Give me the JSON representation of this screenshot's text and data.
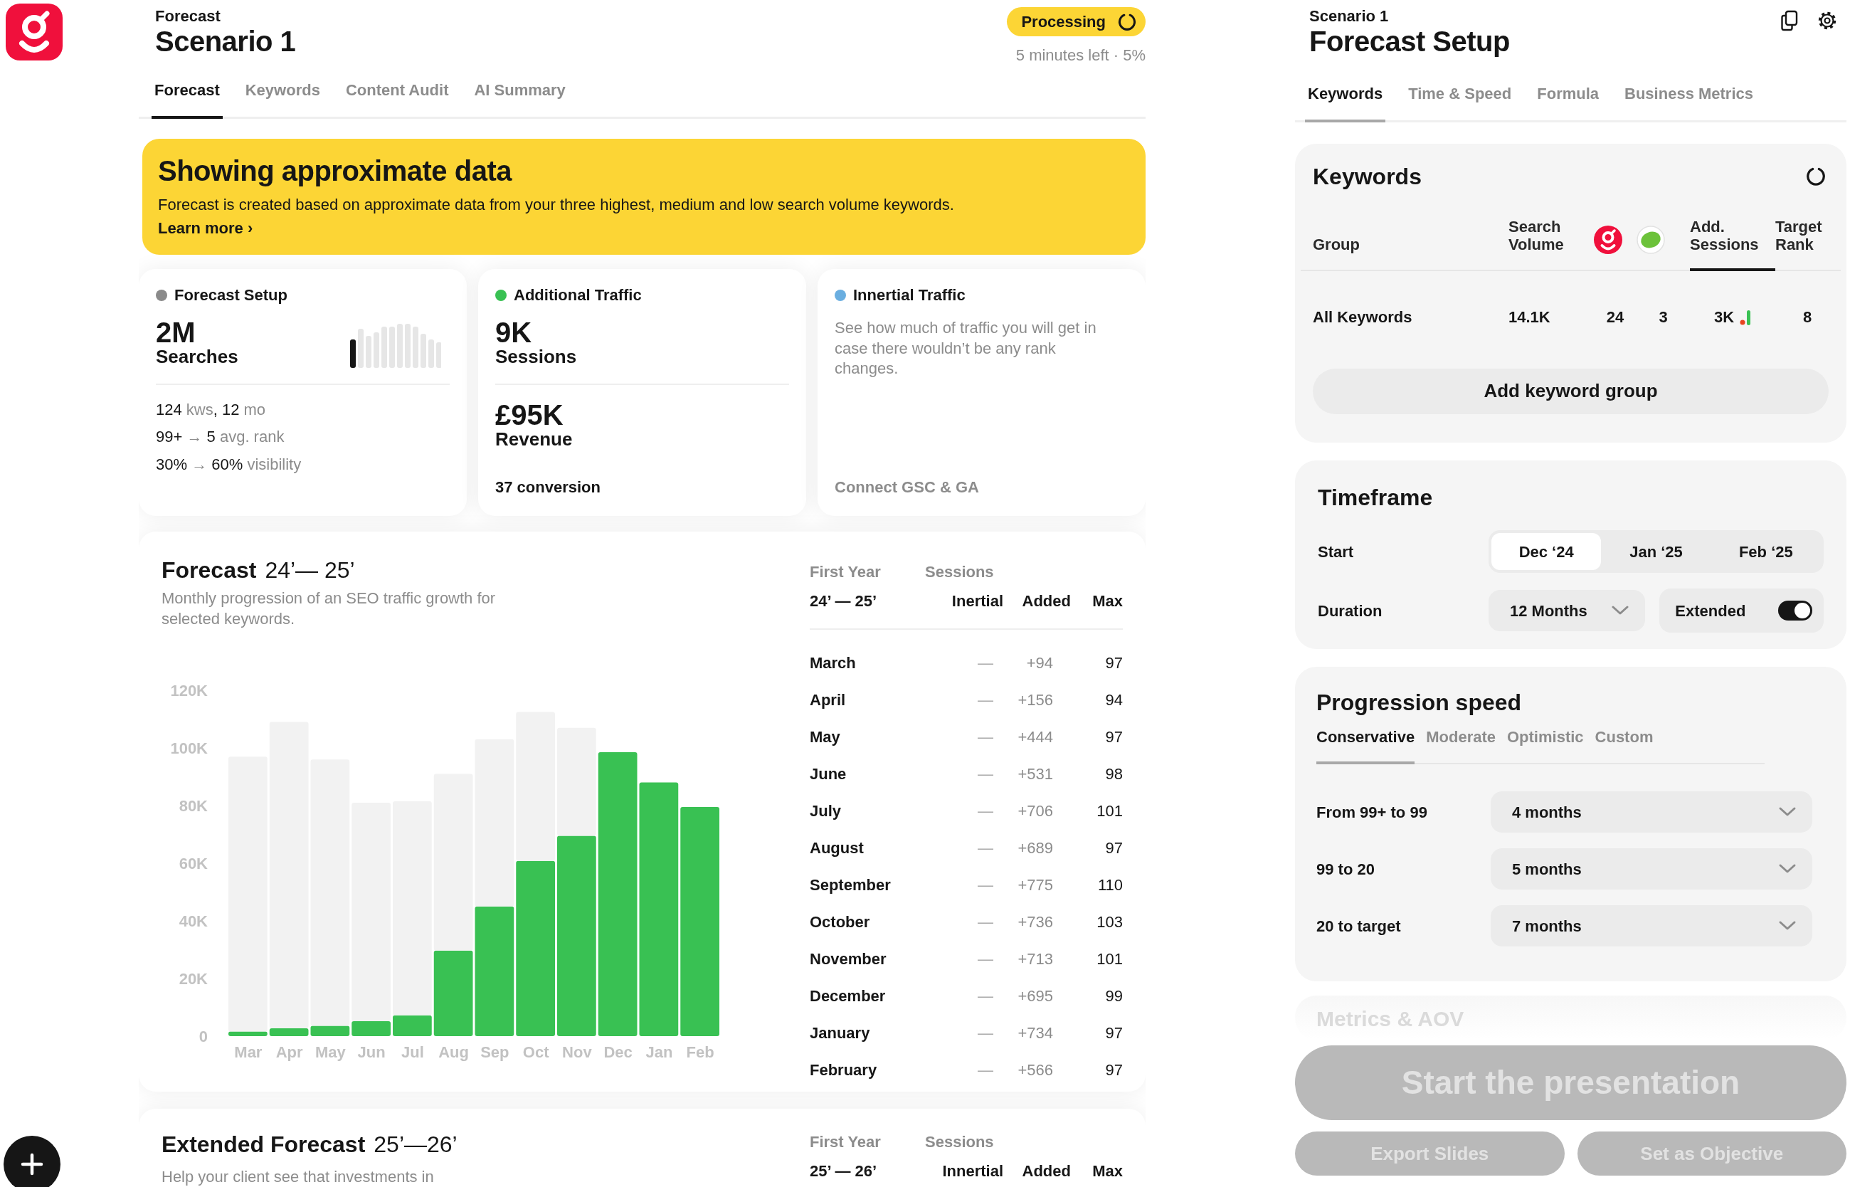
{
  "header": {
    "eyebrow": "Forecast",
    "title": "Scenario 1",
    "status": "Processing",
    "status_detail": "5 minutes left · 5%"
  },
  "tabs": [
    {
      "label": "Forecast",
      "selected": true
    },
    {
      "label": "Keywords",
      "selected": false
    },
    {
      "label": "Content Audit",
      "selected": false
    },
    {
      "label": "AI Summary",
      "selected": false
    }
  ],
  "banner": {
    "title": "Showing approximate data",
    "text": "Forecast is created based on approximate data from your three highest, medium and low search volume keywords.",
    "link": "Learn more ›"
  },
  "summary_cards": [
    {
      "kind": "setup",
      "title": "Forecast Setup",
      "color": "#8a8a8a",
      "value": "2M",
      "unit": "Searches",
      "stats": [
        "**124** kws**, 12** mo",
        "**99+** → **5** avg. rank",
        "**30%** → **60%** visibility"
      ]
    },
    {
      "kind": "traffic",
      "title": "Additional Traffic",
      "color": "#39c153",
      "value": "9K",
      "unit": "Sessions",
      "value_2": "£95K",
      "unit_2": "Revenue",
      "footer": "37 conversion"
    },
    {
      "kind": "info",
      "title": "Innertial Traffic",
      "color": "#6aaee0",
      "text": "See how much of traffic you will get in case there wouldn’t be any rank changes.",
      "link": "Connect GSC & GA"
    }
  ],
  "forecast": {
    "title": "Forecast",
    "period": "24’— 25’",
    "subtitle": "Monthly progression of an SEO traffic growth for selected keywords.",
    "chart_data": {
      "type": "bar",
      "stacked": true,
      "categories": [
        "Mar",
        "Apr",
        "May",
        "Jun",
        "Jul",
        "Aug",
        "Sep",
        "Oct",
        "Nov",
        "Dec",
        "Jan",
        "Feb"
      ],
      "series": [
        {
          "color": "#39c153",
          "values": [
            1600,
            2700,
            3600,
            5200,
            7200,
            29700,
            45000,
            60800,
            69500,
            98500,
            88000,
            79500
          ]
        },
        {
          "color": "#f2f2f2",
          "values": [
            95400,
            106300,
            92400,
            75800,
            74300,
            61300,
            58000,
            51700,
            37500,
            0,
            0,
            0
          ]
        }
      ],
      "ylim": [
        0,
        120000
      ],
      "yticks": [
        0,
        {
          "value": 20000,
          "label": "20K"
        },
        {
          "value": 40000,
          "label": "40K"
        },
        {
          "value": 60000,
          "label": "60K"
        },
        {
          "value": 80000,
          "label": "80K"
        },
        {
          "value": 100000,
          "label": "100K"
        },
        {
          "value": 120000,
          "label": "120K"
        }
      ]
    },
    "table": {
      "group_label": "First Year",
      "group_value": "24’ — 25’",
      "sessions_label": "Sessions",
      "columns": [
        "Inertial",
        "Added",
        "Max"
      ],
      "rows": [
        {
          "month": "March",
          "inertial": "—",
          "added": "+94",
          "max": "97"
        },
        {
          "month": "April",
          "inertial": "—",
          "added": "+156",
          "max": "94"
        },
        {
          "month": "May",
          "inertial": "—",
          "added": "+444",
          "max": "97"
        },
        {
          "month": "June",
          "inertial": "—",
          "added": "+531",
          "max": "98"
        },
        {
          "month": "July",
          "inertial": "—",
          "added": "+706",
          "max": "101"
        },
        {
          "month": "August",
          "inertial": "—",
          "added": "+689",
          "max": "97"
        },
        {
          "month": "September",
          "inertial": "—",
          "added": "+775",
          "max": "110"
        },
        {
          "month": "October",
          "inertial": "—",
          "added": "+736",
          "max": "103"
        },
        {
          "month": "November",
          "inertial": "—",
          "added": "+713",
          "max": "101"
        },
        {
          "month": "December",
          "inertial": "—",
          "added": "+695",
          "max": "99"
        },
        {
          "month": "January",
          "inertial": "—",
          "added": "+734",
          "max": "97"
        },
        {
          "month": "February",
          "inertial": "—",
          "added": "+566",
          "max": "97"
        }
      ]
    }
  },
  "extended_forecast": {
    "title": "Extended Forecast",
    "period": "25’—26’",
    "subtitle": "Help your client see that investments in",
    "table": {
      "group_label": "First Year",
      "group_value": "25’ — 26’",
      "sessions_label": "Sessions",
      "columns": [
        "Innertial",
        "Added",
        "Max"
      ]
    }
  },
  "setup": {
    "eyebrow": "Scenario 1",
    "title": "Forecast Setup",
    "tabs": [
      {
        "label": "Keywords",
        "selected": true
      },
      {
        "label": "Time & Speed",
        "selected": false
      },
      {
        "label": "Formula",
        "selected": false
      },
      {
        "label": "Business Metrics",
        "selected": false
      }
    ],
    "keywords": {
      "title": "Keywords",
      "columns": [
        {
          "kind": "text",
          "label": "Group",
          "selected": false
        },
        {
          "kind": "text",
          "label": "Search Volume",
          "selected": false
        },
        {
          "kind": "icon",
          "selected": false
        },
        {
          "kind": "icon",
          "selected": false
        },
        {
          "kind": "metric",
          "label": "Add. Sessions",
          "selected": true
        },
        {
          "kind": "text",
          "label": "Target Rank",
          "selected": false
        }
      ],
      "rows": [
        {
          "cells": [
            "All Keywords",
            "14.1K",
            "24",
            "3",
            "3K",
            "8"
          ]
        }
      ],
      "add_button": "Add keyword group"
    },
    "timeframe": {
      "title": "Timeframe",
      "start_label": "Start",
      "start_options": [
        {
          "label": "Dec ‘24",
          "selected": true
        },
        {
          "label": "Jan ‘25",
          "selected": false
        },
        {
          "label": "Feb ‘25",
          "selected": false
        }
      ],
      "duration_label": "Duration",
      "duration": "12 Months",
      "extended": {
        "label": "Extended",
        "on": true
      }
    },
    "progression": {
      "title": "Progression speed",
      "tabs": [
        {
          "label": "Conservative",
          "selected": true
        },
        {
          "label": "Moderate",
          "selected": false
        },
        {
          "label": "Optimistic",
          "selected": false
        },
        {
          "label": "Custom",
          "selected": false
        }
      ],
      "rows": [
        {
          "label": "From 99+ to 99",
          "value": "4 months"
        },
        {
          "label": "99 to 20",
          "value": "5 months"
        },
        {
          "label": "20 to target",
          "value": "7 months"
        }
      ]
    },
    "metrics": {
      "title": "Metrics & AOV"
    }
  },
  "actions": [
    {
      "kind": "primary",
      "label": "Start the presentation",
      "disabled": true
    },
    {
      "kind": "secondary",
      "label": "Export Slides",
      "disabled": true
    },
    {
      "kind": "secondary",
      "label": "Set as Objective",
      "disabled": true
    }
  ]
}
